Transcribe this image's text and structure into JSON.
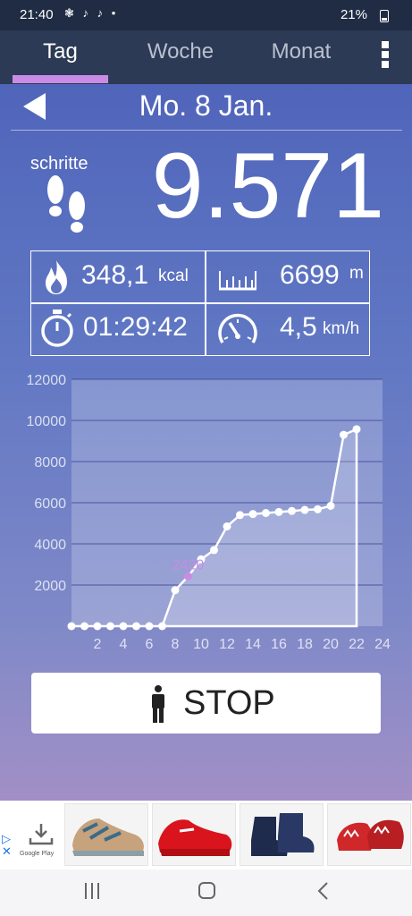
{
  "status_bar": {
    "time": "21:40",
    "battery": "21%",
    "notifications": "❃ ♪ ♪ •"
  },
  "tabs": [
    {
      "label": "Tag",
      "active": true
    },
    {
      "label": "Woche",
      "active": false
    },
    {
      "label": "Monat",
      "active": false
    }
  ],
  "date": "Mo. 8 Jan.",
  "steps": {
    "label": "schritte",
    "value": "9.571"
  },
  "stats": {
    "calories": {
      "value": "348,1",
      "unit": "kcal"
    },
    "distance": {
      "value": "6699",
      "unit": "m"
    },
    "duration": {
      "value": "01:29:42"
    },
    "speed": {
      "value": "4,5",
      "unit": "km/h"
    }
  },
  "chart_data": {
    "type": "area",
    "x": [
      0,
      1,
      2,
      3,
      4,
      5,
      6,
      7,
      8,
      9,
      10,
      11,
      12,
      13,
      14,
      15,
      16,
      17,
      18,
      19,
      20,
      21,
      22
    ],
    "y": [
      0,
      0,
      0,
      0,
      0,
      0,
      0,
      0,
      1750,
      2420,
      3250,
      3700,
      4850,
      5400,
      5450,
      5500,
      5550,
      5600,
      5650,
      5680,
      5850,
      9300,
      9571
    ],
    "xticks": [
      "2",
      "4",
      "6",
      "8",
      "10",
      "12",
      "14",
      "16",
      "18",
      "20",
      "22",
      "24"
    ],
    "yticks": [
      "2000",
      "4000",
      "6000",
      "8000",
      "10000",
      "12000"
    ],
    "xlim": [
      0,
      24
    ],
    "ylim": [
      0,
      12000
    ],
    "highlight": {
      "x": 9,
      "label": "2420"
    },
    "grid": true
  },
  "stop_button": {
    "label": "STOP"
  },
  "ad": {
    "store_label": "Google Play"
  },
  "colors": {
    "tab_indicator": "#c98be6",
    "highlight": "#c98be6",
    "gradient_top": "#5065ba",
    "gradient_bottom": "#a28fc6"
  }
}
